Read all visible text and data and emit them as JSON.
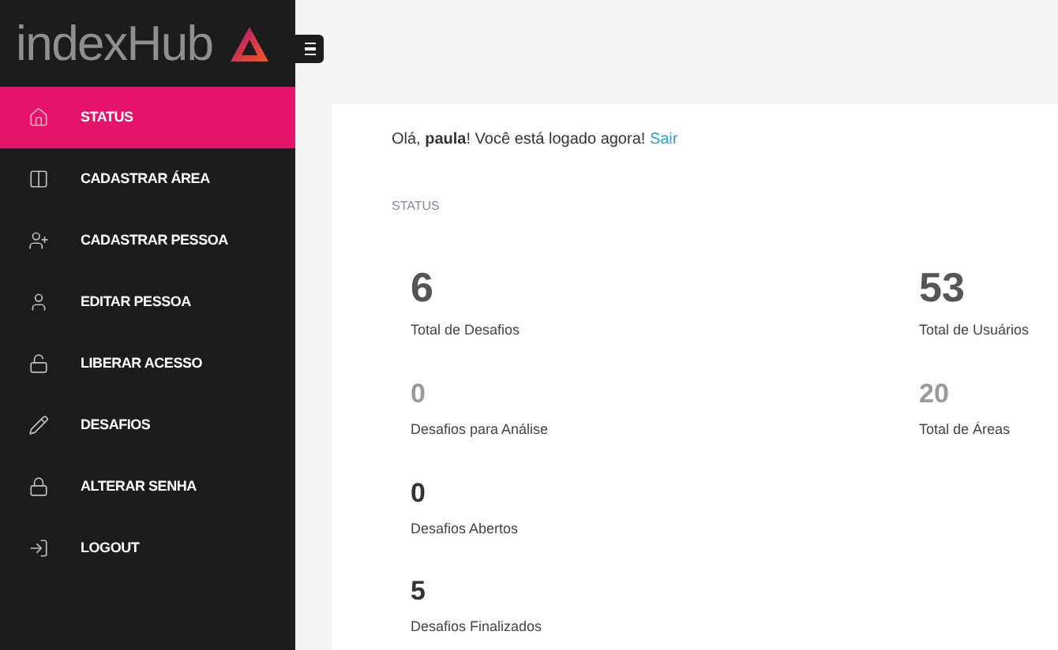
{
  "logo": {
    "text": "indexHub"
  },
  "sidebar": {
    "items": [
      {
        "label": "STATUS",
        "selected": true
      },
      {
        "label": "CADASTRAR ÁREA",
        "selected": false
      },
      {
        "label": "CADASTRAR PESSOA",
        "selected": false
      },
      {
        "label": "EDITAR PESSOA",
        "selected": false
      },
      {
        "label": "LIBERAR ACESSO",
        "selected": false
      },
      {
        "label": "DESAFIOS",
        "selected": false
      },
      {
        "label": "ALTERAR SENHA",
        "selected": false
      },
      {
        "label": "LOGOUT",
        "selected": false
      }
    ]
  },
  "greeting": {
    "text": "Olá, **paula**! Você está logado agora!",
    "link": "Sair"
  },
  "section_title": "STATUS",
  "stats_left": [
    {
      "value": "6",
      "label": "Total de Desafios",
      "kind": "large"
    },
    {
      "value": "0",
      "label": "Desafios para Análise",
      "kind": "muted"
    },
    {
      "value": "0",
      "label": "Desafios Abertos",
      "kind": "normal"
    },
    {
      "value": "5",
      "label": "Desafios Finalizados",
      "kind": "normal"
    }
  ],
  "stats_right": [
    {
      "value": "53",
      "label": "Total de Usuários",
      "kind": "large"
    },
    {
      "value": "20",
      "label": "Total de Áreas",
      "kind": "muted"
    }
  ]
}
